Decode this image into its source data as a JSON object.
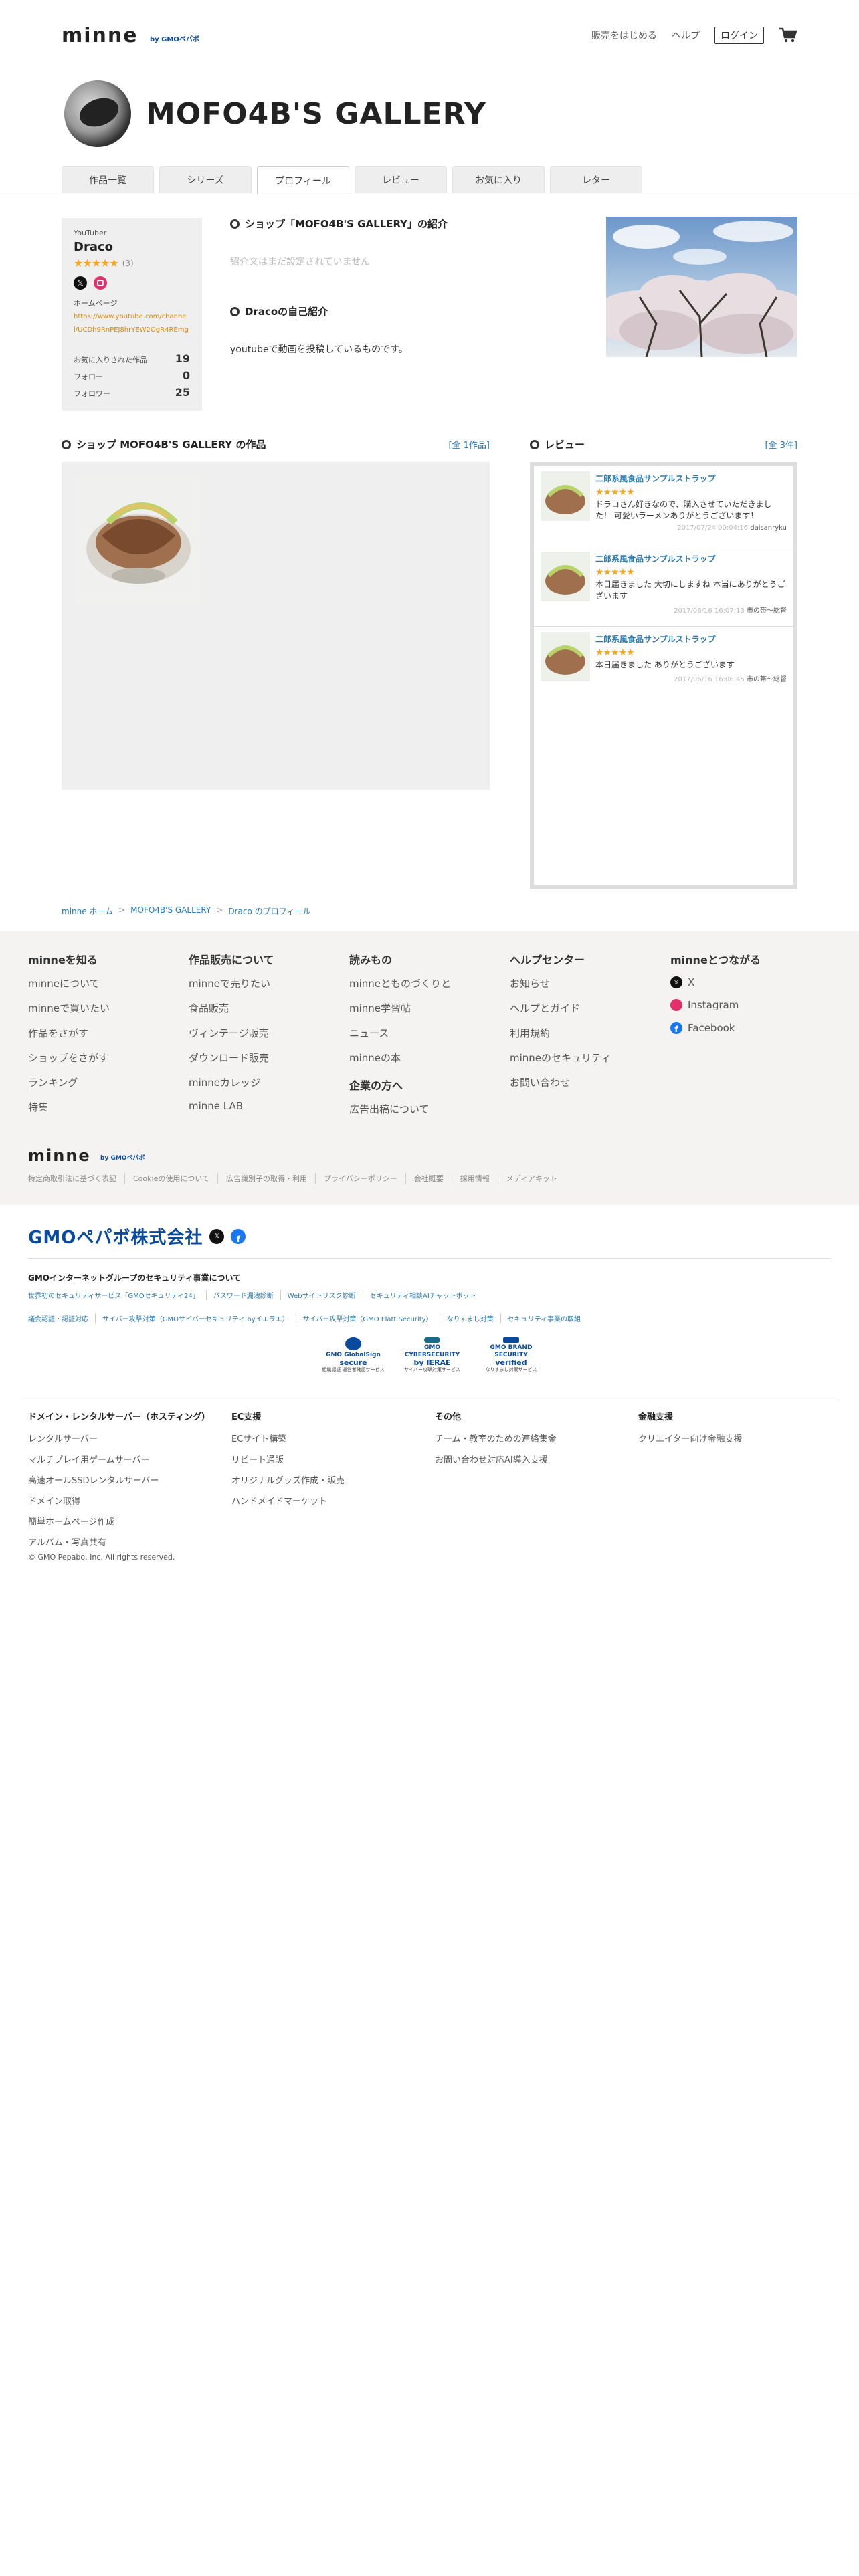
{
  "header": {
    "logo": "minne",
    "logo_sub": "by GMOペパボ",
    "nav": [
      "販売をはじめる",
      "ヘルプ"
    ],
    "login": "ログイン"
  },
  "shop": {
    "name": "MOFO4B'S GALLERY"
  },
  "tabs": [
    {
      "label": "作品一覧"
    },
    {
      "label": "シリーズ"
    },
    {
      "label": "プロフィール",
      "active": true
    },
    {
      "label": "レビュー"
    },
    {
      "label": "お気に入り"
    },
    {
      "label": "レター"
    }
  ],
  "profile": {
    "title": "YouTuber",
    "name": "Draco",
    "stars": "★★★★★",
    "rating_count": "(3)",
    "homepage_label": "ホームページ",
    "homepage_url": "https://www.youtube.com/channel/UCDh9RnPEJ8hrYEW2OgR4REmg",
    "stats": [
      {
        "label": "お気に入りされた作品",
        "value": "19"
      },
      {
        "label": "フォロー",
        "value": "0"
      },
      {
        "label": "フォロワー",
        "value": "25"
      }
    ]
  },
  "intro": {
    "heading": "ショップ「MOFO4B'S GALLERY」の紹介",
    "empty_text": "紹介文はまだ設定されていません",
    "self_heading": "Dracoの自己紹介",
    "self_text": "youtubeで動画を投稿しているものです。"
  },
  "works": {
    "heading": "ショップ MOFO4B'S GALLERY の作品",
    "all_link": "[全 1作品]"
  },
  "reviews": {
    "heading": "レビュー",
    "all_link": "[全 3件]",
    "items": [
      {
        "title": "二郎系風食品サンプルストラップ",
        "stars": "★★★★★",
        "text": "ドラコさん好きなので、購入させていただきました！ 可愛いラーメンありがとうございます！",
        "date": "2017/07/24 00:04:16",
        "user": "daisanryku"
      },
      {
        "title": "二郎系風食品サンプルストラップ",
        "stars": "★★★★★",
        "text": "本日届きました 大切にしますね 本当にありがとうございます",
        "date": "2017/06/16 16:07:13",
        "user": "市の帯〜総督"
      },
      {
        "title": "二郎系風食品サンプルストラップ",
        "stars": "★★★★★",
        "text": "本日届きました ありがとうございます",
        "date": "2017/06/16 16:06:45",
        "user": "市の帯〜総督"
      }
    ]
  },
  "breadcrumb": [
    "minne ホーム",
    "MOFO4B'S GALLERY",
    "Draco のプロフィール"
  ],
  "breadcrumb_sep": ">",
  "footer": {
    "columns": [
      {
        "heading": "minneを知る",
        "items": [
          "minneについて",
          "minneで買いたい",
          "作品をさがす",
          "ショップをさがす",
          "ランキング",
          "特集"
        ]
      },
      {
        "heading": "作品販売について",
        "items": [
          "minneで売りたい",
          "食品販売",
          "ヴィンテージ販売",
          "ダウンロード販売",
          "minneカレッジ",
          "minne LAB"
        ]
      },
      {
        "heading": "読みもの",
        "items": [
          "minneとものづくりと",
          "minne学習帖",
          "ニュース",
          "minneの本"
        ],
        "sub_heading": "企業の方へ",
        "sub_items": [
          "広告出稿について"
        ]
      },
      {
        "heading": "ヘルプセンター",
        "items": [
          "お知らせ",
          "ヘルプとガイド",
          "利用規約",
          "minneのセキュリティ",
          "お問い合わせ"
        ]
      },
      {
        "heading": "minneとつながる",
        "items": [
          "X",
          "Instagram",
          "Facebook"
        ]
      }
    ],
    "logo": "minne",
    "logo_sub": "by GMOペパボ",
    "links": [
      "特定商取引法に基づく表記",
      "Cookieの使用について",
      "広告識別子の取得・利用",
      "プライバシーポリシー",
      "会社概要",
      "採用情報",
      "メディアキット"
    ]
  },
  "gmo": {
    "company": "GMOペパボ株式会社",
    "security_title": "GMOインターネットグループのセキュリティ事業について",
    "security_links": [
      "世界初のセキュリティサービス「GMOセキュリティ24」",
      "パスワード漏洩診断",
      "Webサイトリスク診断",
      "セキュリティ相談AIチャットボット",
      "議会認証・認証対応",
      "サイバー攻撃対策（GMOサイバーセキュリティ byイエラエ）",
      "サイバー攻撃対策（GMO Flatt Security）",
      "なりすまし対策",
      "セキュリティ事業の取組"
    ],
    "badges": [
      {
        "top": "GMO GlobalSign",
        "main": "secure",
        "note": "組織認証 運営者確認サービス"
      },
      {
        "top": "GMO CYBERSECURITY",
        "main": "by IERAE",
        "note": "サイバー攻撃対策サービス"
      },
      {
        "top": "GMO BRAND SECURITY",
        "main": "verified",
        "note": "なりすまし対策サービス"
      }
    ],
    "services": [
      {
        "heading": "ドメイン・レンタルサーバー（ホスティング）",
        "items": [
          "レンタルサーバー",
          "マルチプレイ用ゲームサーバー",
          "高速オールSSDレンタルサーバー",
          "ドメイン取得",
          "簡単ホームページ作成",
          "アルバム・写真共有"
        ]
      },
      {
        "heading": "EC支援",
        "items": [
          "ECサイト構築",
          "リピート通販",
          "オリジナルグッズ作成・販売",
          "ハンドメイドマーケット"
        ]
      },
      {
        "heading": "その他",
        "items": [
          "チーム・教室のための連絡集金",
          "お問い合わせ対応AI導入支援"
        ]
      },
      {
        "heading": "金融支援",
        "items": [
          "クリエイター向け金融支援"
        ]
      }
    ],
    "copyright": "© GMO Pepabo, Inc. All rights reserved."
  },
  "colors": {
    "accent_link": "#2a7ab0",
    "star": "#f5a623",
    "gmo_blue": "#0a4a9c",
    "footer_bg": "#f4f3f1"
  }
}
